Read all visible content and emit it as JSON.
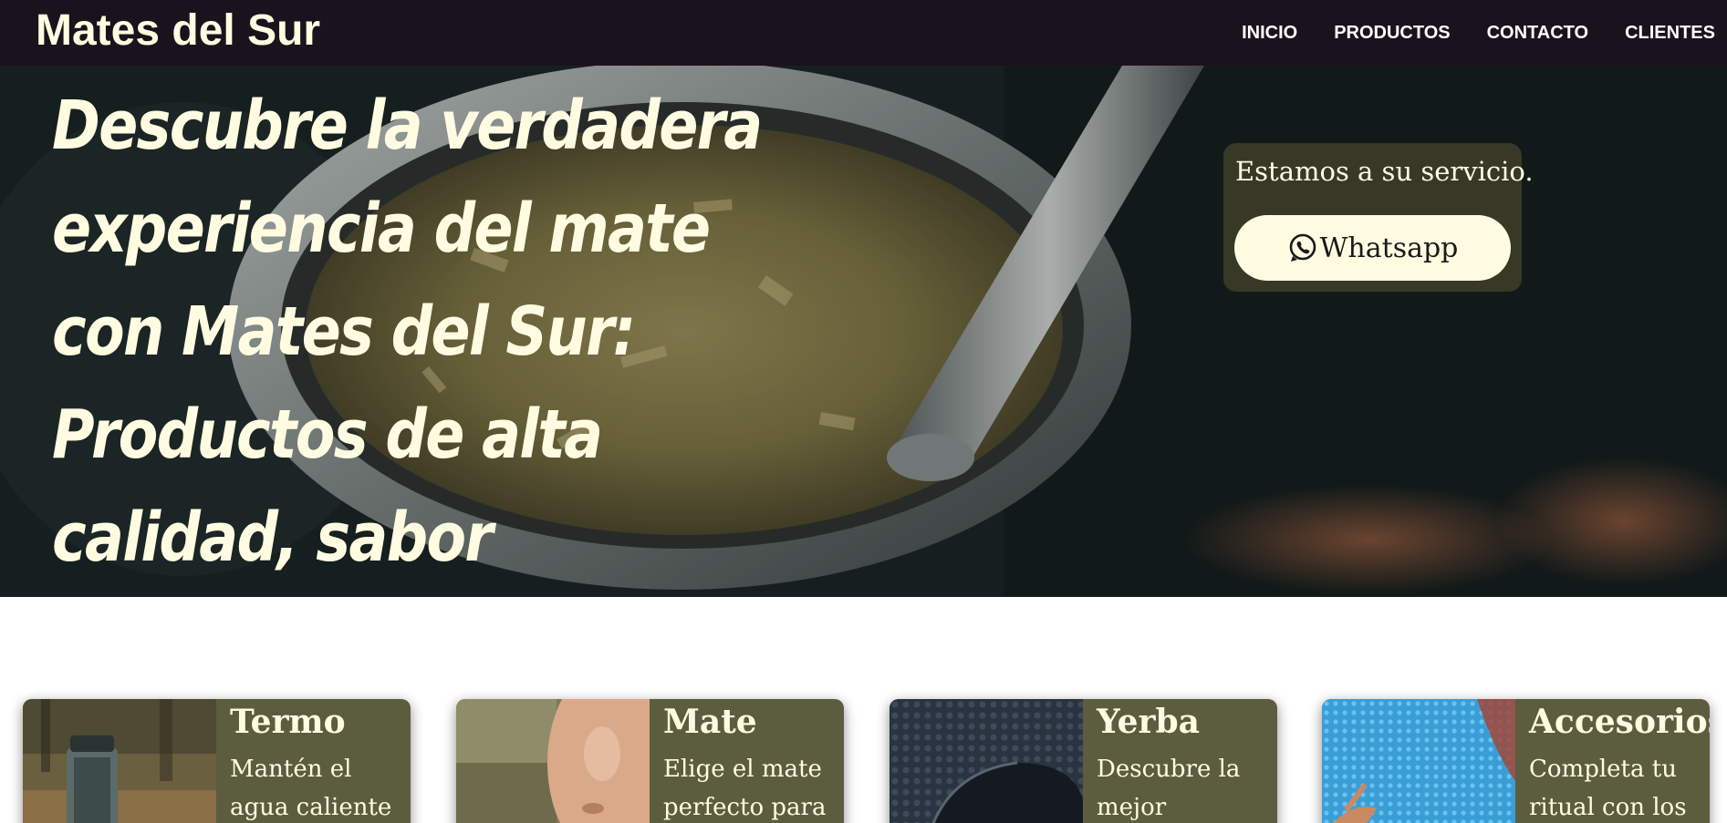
{
  "navbar": {
    "brand": "Mates del Sur",
    "links": [
      "INICIO",
      "PRODUCTOS",
      "CONTACTO",
      "CLIENTES"
    ]
  },
  "hero": {
    "title": "Descubre la verdadera experiencia del mate con Mates del Sur: Productos de alta calidad, sabor auténtico y estilo único.",
    "service_text": "Estamos a su servicio.",
    "whatsapp_label": "Whatsapp"
  },
  "products": [
    {
      "title": "Termo",
      "desc": "Mantén el agua caliente"
    },
    {
      "title": "Mate",
      "desc": "Elige el mate perfecto para"
    },
    {
      "title": "Yerba",
      "desc": "Descubre la mejor"
    },
    {
      "title": "Accesorios",
      "desc": "Completa tu ritual con los"
    }
  ],
  "colors": {
    "navbar_bg": "#1a121c",
    "cream": "#fffce2",
    "card_bg": "#5c5d3e"
  }
}
